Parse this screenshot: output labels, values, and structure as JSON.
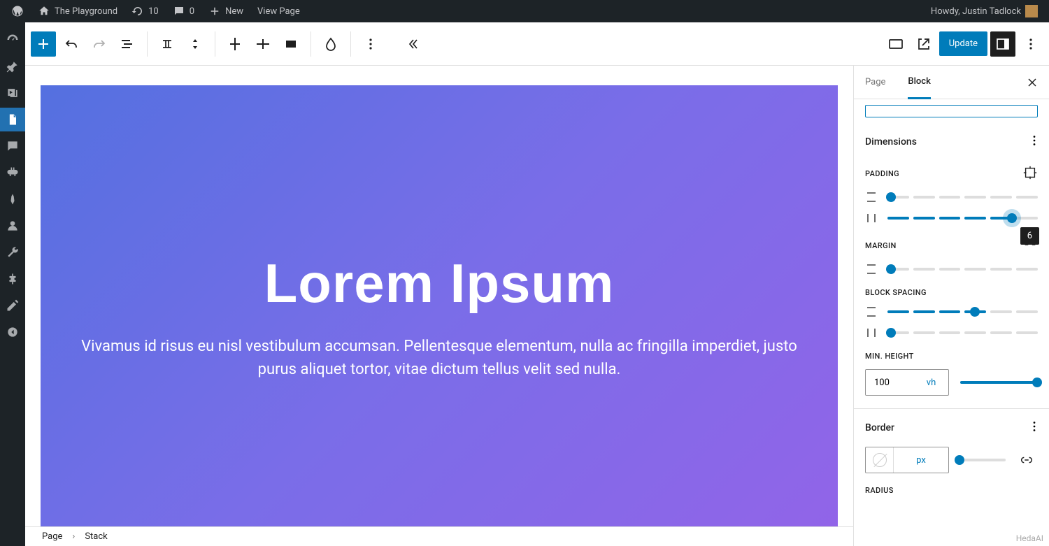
{
  "adminbar": {
    "site": "The Playground",
    "updates": "10",
    "comments": "0",
    "new": "New",
    "viewpage": "View Page",
    "howdy": "Howdy, Justin Tadlock"
  },
  "toolbar": {
    "update": "Update"
  },
  "canvas": {
    "heading": "Lorem Ipsum",
    "paragraph": "Vivamus id risus eu nisl vestibulum accumsan. Pellentesque elementum, nulla ac fringilla imperdiet, justo purus aliquet tortor, vitae dictum tellus velit sed nulla."
  },
  "breadcrumb": {
    "root": "Page",
    "leaf": "Stack"
  },
  "sidebar": {
    "tab_page": "Page",
    "tab_block": "Block",
    "dimensions": "Dimensions",
    "padding": "PADDING",
    "padding_tooltip": "6",
    "margin": "MARGIN",
    "blockspacing": "BLOCK SPACING",
    "minheight": "MIN. HEIGHT",
    "minheight_value": "100",
    "minheight_unit": "vh",
    "border": "Border",
    "border_unit": "px",
    "radius": "RADIUS"
  },
  "watermark": "HedaAI"
}
